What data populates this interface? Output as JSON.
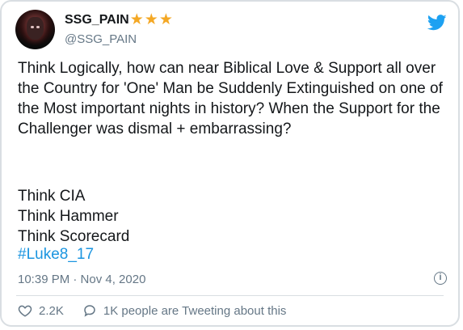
{
  "user": {
    "display_name": "SSG_PAIN",
    "stars": "★★★",
    "handle": "@SSG_PAIN"
  },
  "tweet": {
    "paragraph": "Think Logically, how can near Biblical Love & Support all over the Country for 'One' Man be Suddenly Extinguished on one of the Most important nights in history? When the Support for the Challenger was dismal + embarrassing?",
    "lines": [
      "Think CIA",
      "Think Hammer",
      "Think Scorecard"
    ],
    "hashtag": "#Luke8_17",
    "timestamp": "10:39 PM · Nov 4, 2020"
  },
  "actions": {
    "likes": "2.2K",
    "replies_text": "1K people are Tweeting about this"
  },
  "icons": {
    "brand": "twitter-bird-icon",
    "info": "info-icon",
    "like": "heart-icon",
    "reply": "speech-bubble-icon"
  },
  "colors": {
    "accent": "#1da1f2",
    "link": "#1b95e0",
    "muted": "#657786",
    "star": "#f4a825"
  }
}
